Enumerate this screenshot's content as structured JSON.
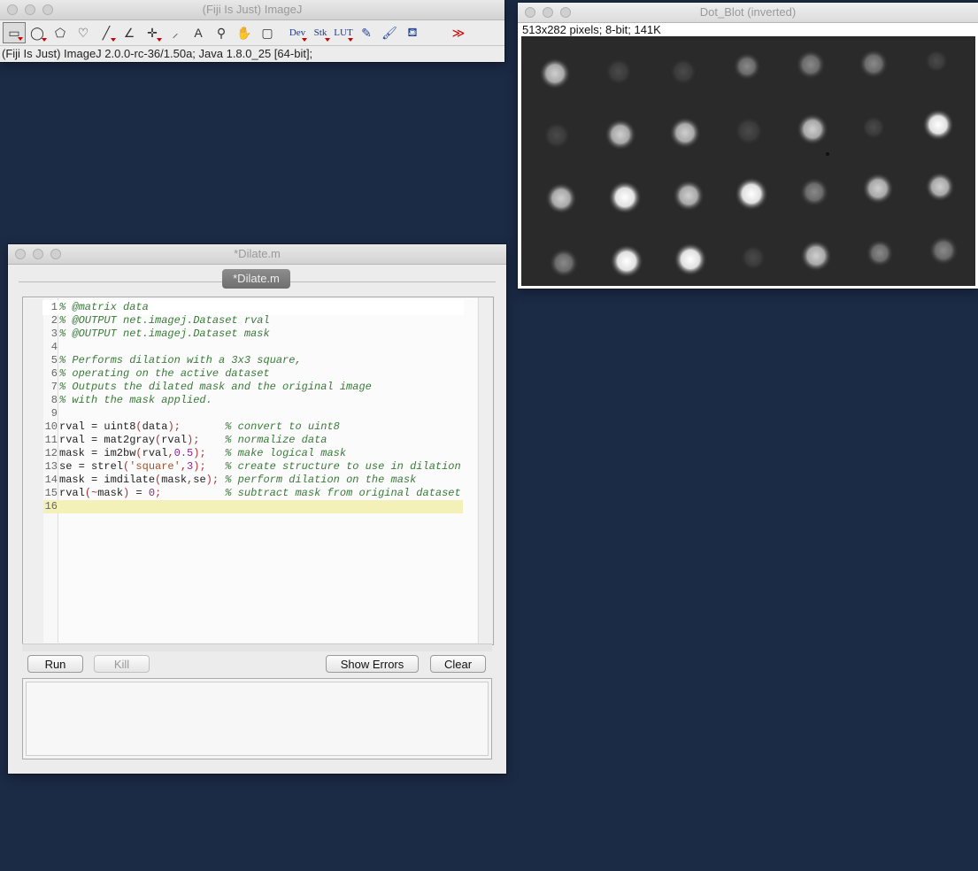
{
  "imagej": {
    "title": "(Fiji Is Just) ImageJ",
    "status": "(Fiji Is Just) ImageJ 2.0.0-rc-36/1.50a; Java 1.8.0_25 [64-bit];",
    "tools": [
      {
        "name": "rectangle-tool-icon",
        "glyph": "▭"
      },
      {
        "name": "oval-tool-icon",
        "glyph": "◯"
      },
      {
        "name": "polygon-tool-icon",
        "glyph": "⬠"
      },
      {
        "name": "freehand-tool-icon",
        "glyph": "♡"
      },
      {
        "name": "line-tool-icon",
        "glyph": "╱"
      },
      {
        "name": "angle-tool-icon",
        "glyph": "∠"
      },
      {
        "name": "point-tool-icon",
        "glyph": "✛"
      },
      {
        "name": "wand-tool-icon",
        "glyph": "⸝"
      },
      {
        "name": "text-tool-icon",
        "glyph": "A"
      },
      {
        "name": "magnifier-tool-icon",
        "glyph": "⚲"
      },
      {
        "name": "hand-tool-icon",
        "glyph": "✋"
      },
      {
        "name": "color-picker-tool-icon",
        "glyph": "▢"
      }
    ],
    "menus": [
      {
        "name": "dev-menu",
        "label": "Dev"
      },
      {
        "name": "stk-menu",
        "label": "Stk"
      },
      {
        "name": "lut-menu",
        "label": "LUT"
      }
    ],
    "extra_tools": [
      {
        "name": "pencil-tool-icon",
        "glyph": "✎"
      },
      {
        "name": "brush-tool-icon",
        "glyph": "🖌"
      },
      {
        "name": "flood-fill-tool-icon",
        "glyph": "⛾"
      }
    ],
    "more_glyph": "≫"
  },
  "image_window": {
    "title": "Dot_Blot (inverted)",
    "info": "513x282 pixels; 8-bit; 141K"
  },
  "editor": {
    "title": "*Dilate.m",
    "tab_label": "*Dilate.m",
    "lines": [
      {
        "n": "1",
        "code": "% @matrix data"
      },
      {
        "n": "2",
        "code": "% @OUTPUT net.imagej.Dataset rval"
      },
      {
        "n": "3",
        "code": "% @OUTPUT net.imagej.Dataset mask"
      },
      {
        "n": "4",
        "code": ""
      },
      {
        "n": "5",
        "code": "% Performs dilation with a 3x3 square,"
      },
      {
        "n": "6",
        "code": "% operating on the active dataset"
      },
      {
        "n": "7",
        "code": "% Outputs the dilated mask and the original image"
      },
      {
        "n": "8",
        "code": "% with the mask applied."
      },
      {
        "n": "9",
        "code": ""
      },
      {
        "n": "10",
        "code": "rval = uint8(data);       % convert to uint8"
      },
      {
        "n": "11",
        "code": "rval = mat2gray(rval);    % normalize data"
      },
      {
        "n": "12",
        "code": "mask = im2bw(rval,0.5);   % make logical mask"
      },
      {
        "n": "13",
        "code": "se = strel('square',3);   % create structure to use in dilation"
      },
      {
        "n": "14",
        "code": "mask = imdilate(mask,se); % perform dilation on the mask"
      },
      {
        "n": "15",
        "code": "rval(~mask) = 0;          % subtract mask from original dataset"
      },
      {
        "n": "16",
        "code": ""
      }
    ],
    "buttons": {
      "run": "Run",
      "kill": "Kill",
      "show_errors": "Show Errors",
      "clear": "Clear"
    }
  }
}
